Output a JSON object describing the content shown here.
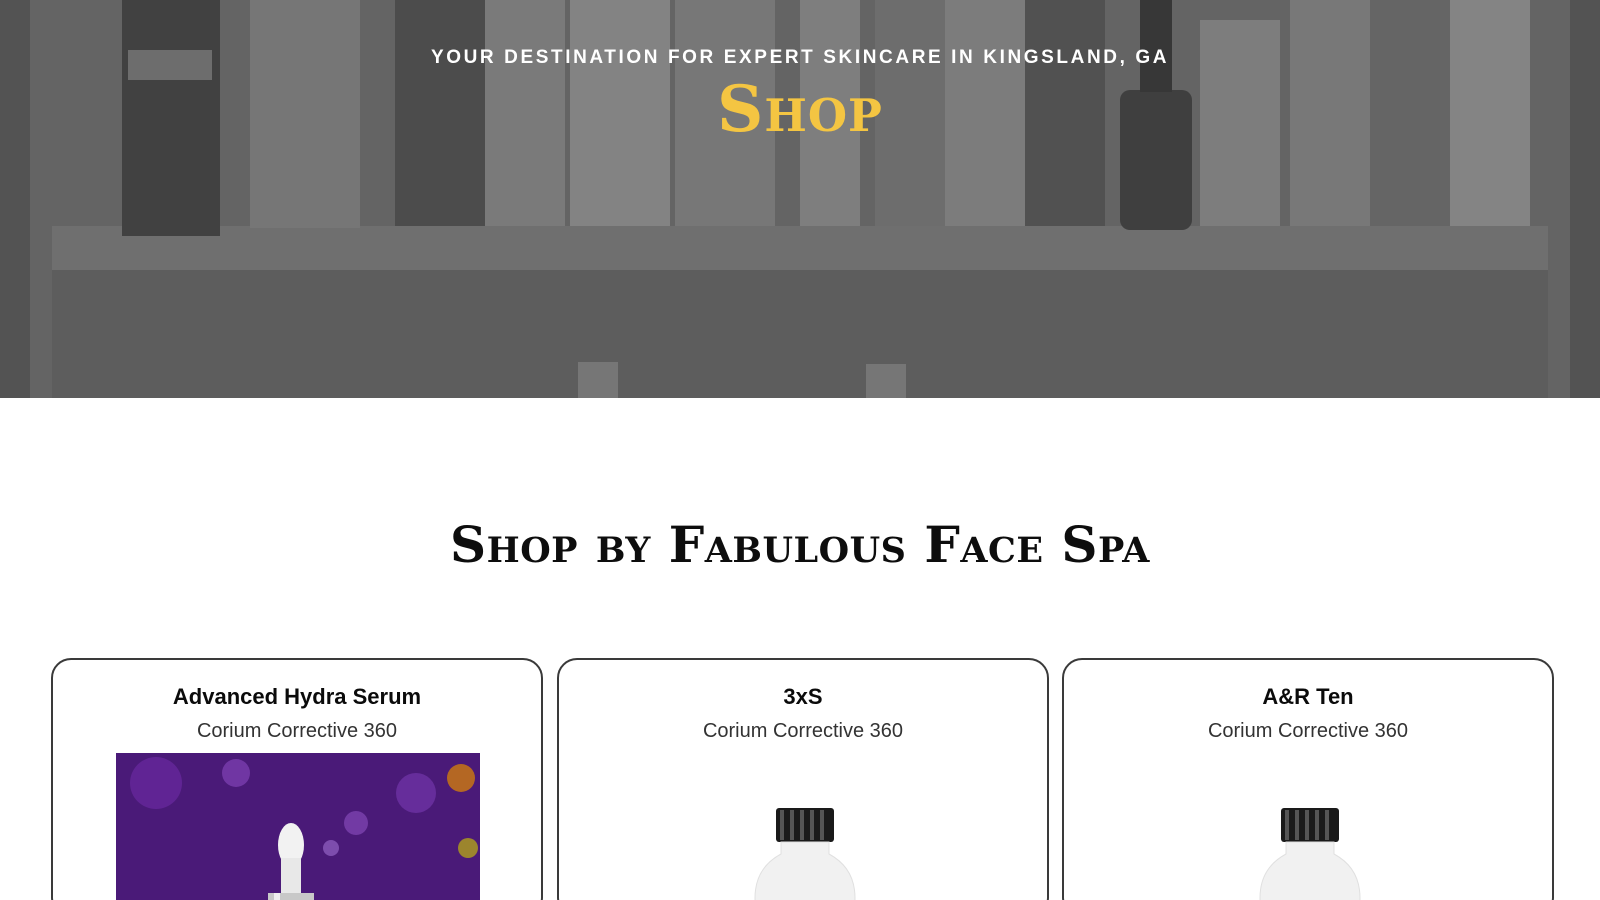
{
  "hero": {
    "eyebrow": "YOUR DESTINATION FOR EXPERT SKINCARE IN KINGSLAND, GA",
    "title": "Shop",
    "title_color": "#f4c542"
  },
  "section": {
    "title": "Shop by Fabulous Face Spa"
  },
  "products": [
    {
      "name": "Advanced Hydra Serum",
      "brand": "Corium Corrective 360",
      "image": "serum-dropper-photo"
    },
    {
      "name": "3xS",
      "brand": "Corium Corrective 360",
      "image": "white-bottle-photo"
    },
    {
      "name": "A&R Ten",
      "brand": "Corium Corrective 360",
      "image": "white-bottle-photo"
    }
  ]
}
